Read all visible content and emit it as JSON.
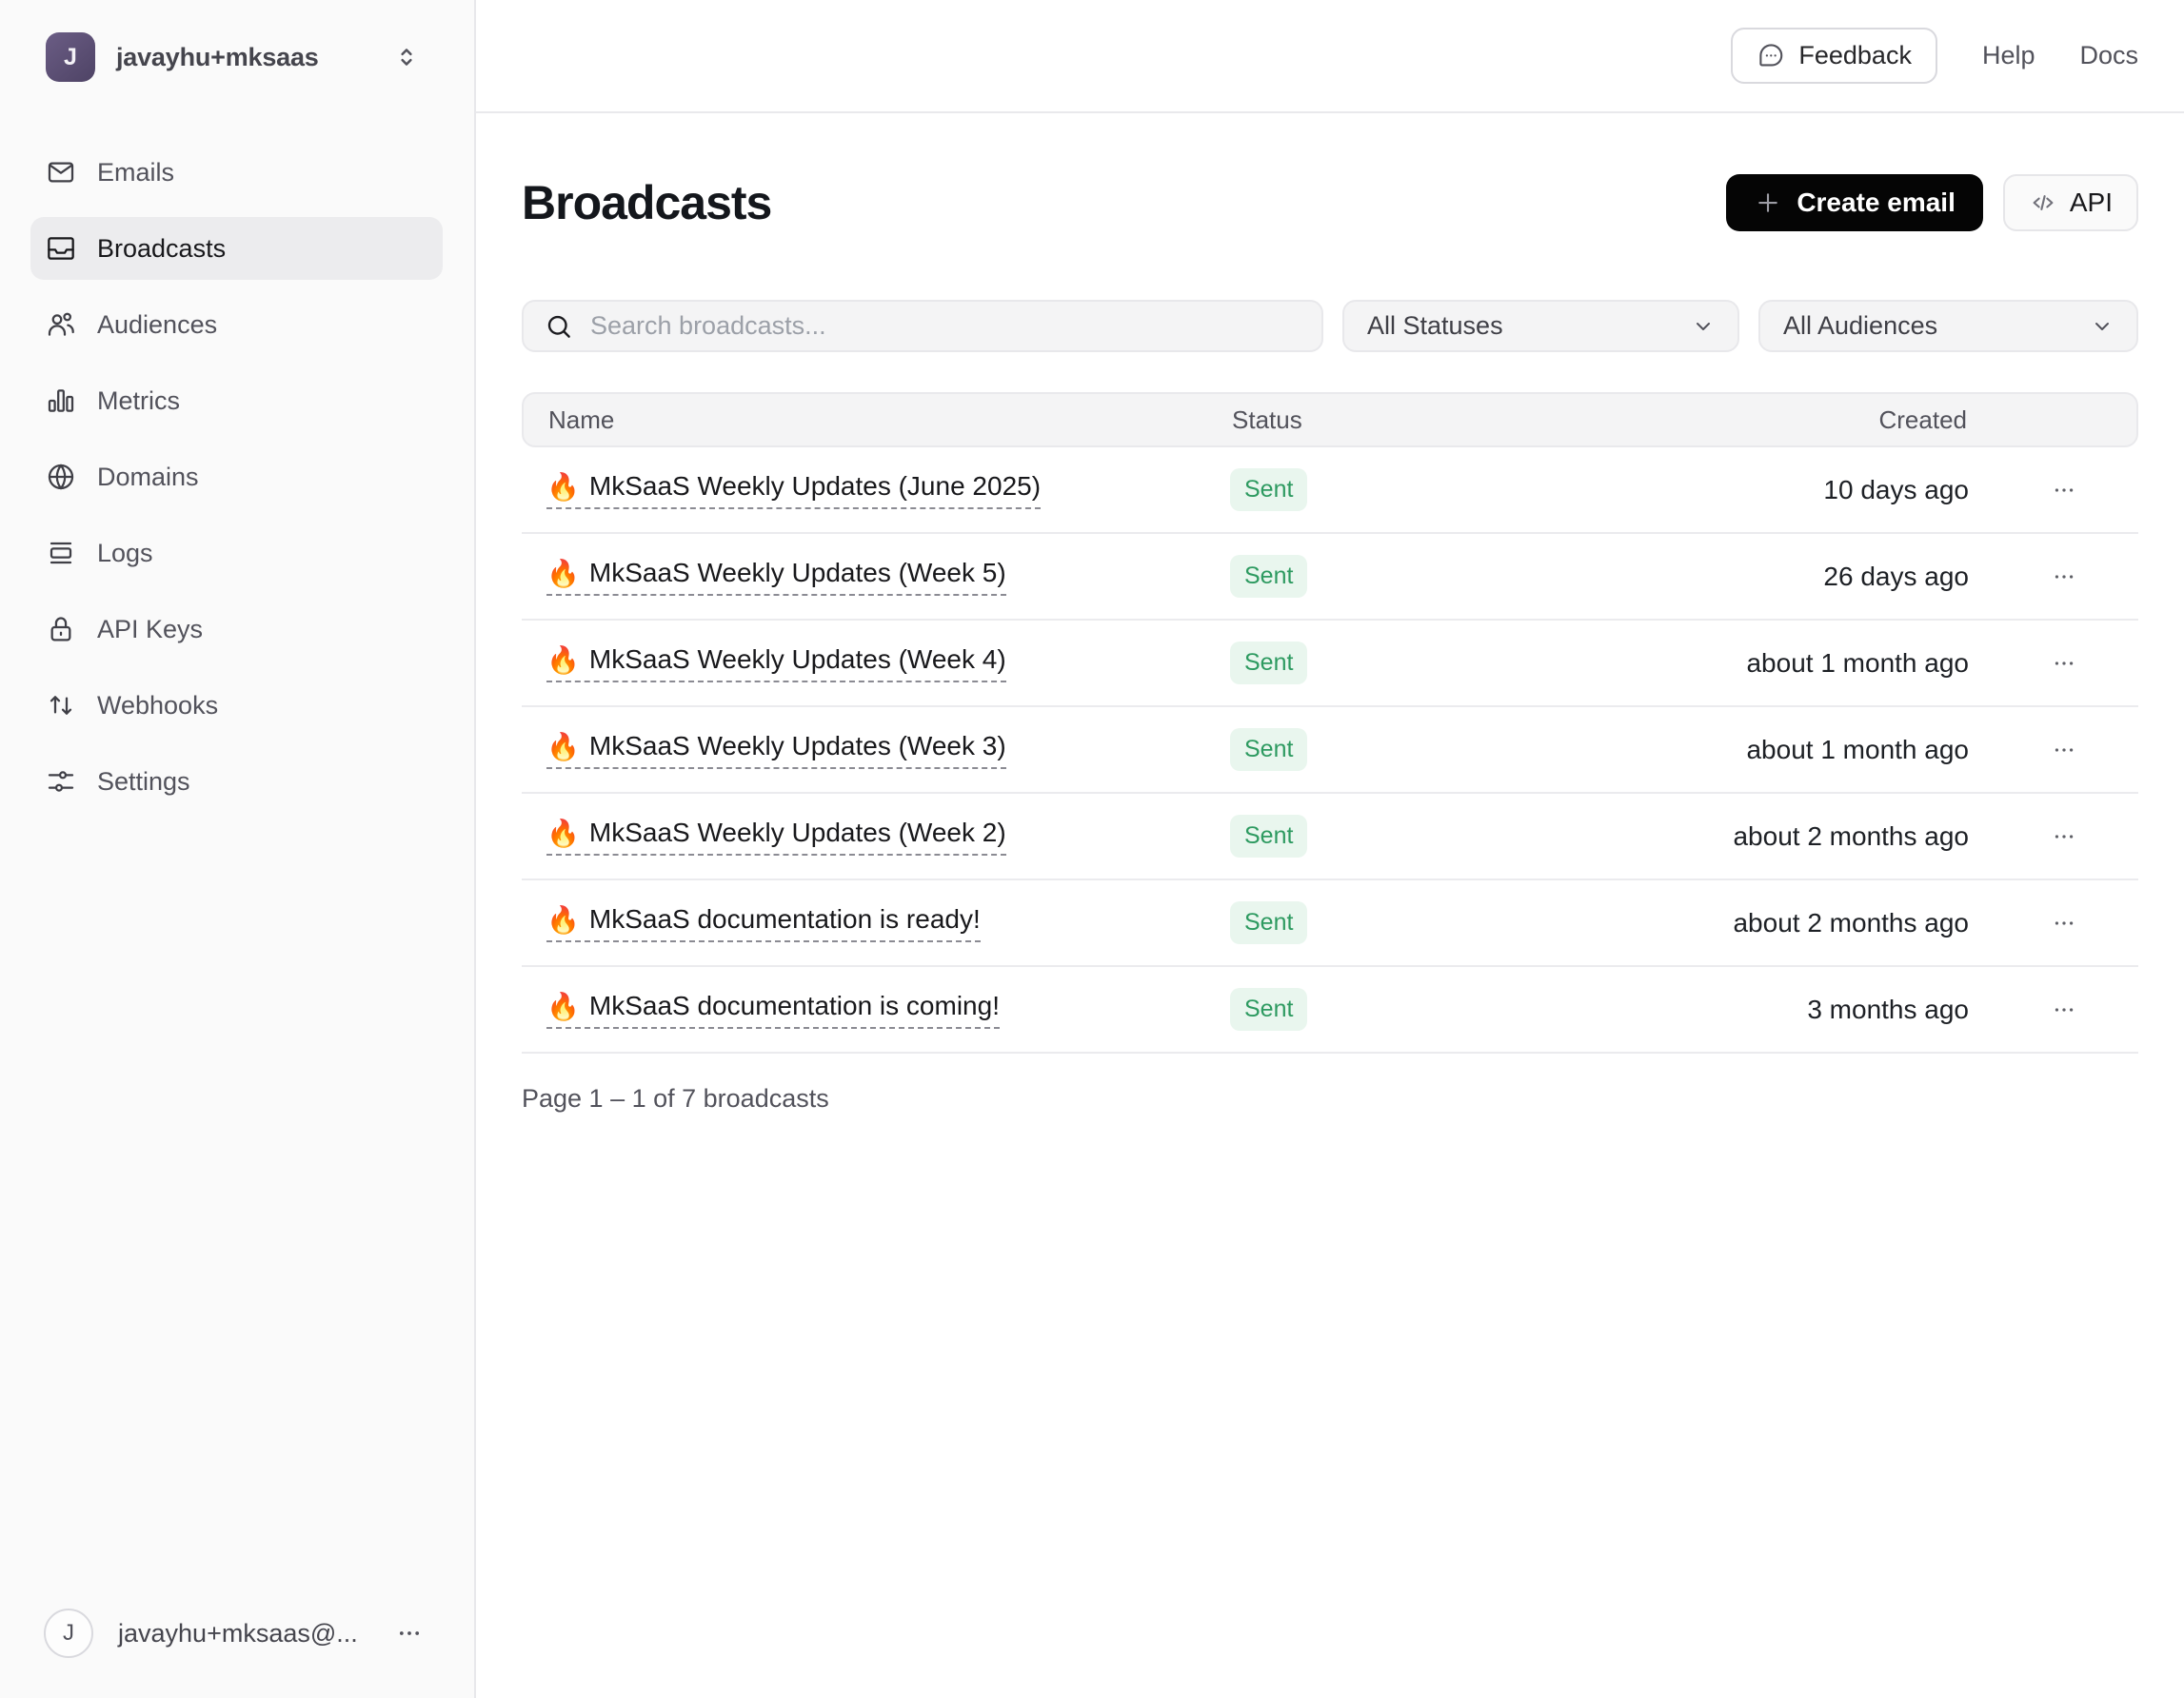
{
  "sidebar": {
    "account": {
      "initial": "J",
      "name": "javayhu+mksaas"
    },
    "items": [
      {
        "label": "Emails",
        "icon": "mail-icon"
      },
      {
        "label": "Broadcasts",
        "icon": "inbox-icon"
      },
      {
        "label": "Audiences",
        "icon": "users-icon"
      },
      {
        "label": "Metrics",
        "icon": "bar-chart-icon"
      },
      {
        "label": "Domains",
        "icon": "globe-icon"
      },
      {
        "label": "Logs",
        "icon": "logs-icon"
      },
      {
        "label": "API Keys",
        "icon": "lock-icon"
      },
      {
        "label": "Webhooks",
        "icon": "arrows-up-down-icon"
      },
      {
        "label": "Settings",
        "icon": "sliders-icon"
      }
    ],
    "footer": {
      "initial": "J",
      "email": "javayhu+mksaas@..."
    }
  },
  "topbar": {
    "feedback_label": "Feedback",
    "help_label": "Help",
    "docs_label": "Docs"
  },
  "page": {
    "title": "Broadcasts",
    "create_email_label": "Create email",
    "api_label": "API",
    "search_placeholder": "Search broadcasts...",
    "status_filter_value": "All Statuses",
    "audience_filter_value": "All Audiences"
  },
  "table": {
    "columns": {
      "name": "Name",
      "status": "Status",
      "created": "Created"
    },
    "rows": [
      {
        "emoji": "🔥",
        "name": "MkSaaS Weekly Updates (June 2025)",
        "status": "Sent",
        "created": "10 days ago"
      },
      {
        "emoji": "🔥",
        "name": "MkSaaS Weekly Updates (Week 5)",
        "status": "Sent",
        "created": "26 days ago"
      },
      {
        "emoji": "🔥",
        "name": "MkSaaS Weekly Updates (Week 4)",
        "status": "Sent",
        "created": "about 1 month ago"
      },
      {
        "emoji": "🔥",
        "name": "MkSaaS Weekly Updates (Week 3)",
        "status": "Sent",
        "created": "about 1 month ago"
      },
      {
        "emoji": "🔥",
        "name": "MkSaaS Weekly Updates (Week 2)",
        "status": "Sent",
        "created": "about 2 months ago"
      },
      {
        "emoji": "🔥",
        "name": "MkSaaS documentation is ready!",
        "status": "Sent",
        "created": "about 2 months ago"
      },
      {
        "emoji": "🔥",
        "name": "MkSaaS documentation is coming!",
        "status": "Sent",
        "created": "3 months ago"
      }
    ],
    "pagination": "Page 1 – 1 of 7 broadcasts"
  },
  "colors": {
    "accent_black": "#050505",
    "badge_bg": "#e9f6ee",
    "badge_text": "#2d9a60",
    "sidebar_bg": "#fafafa",
    "active_item_bg": "#ececee",
    "border": "#e8e8eb",
    "avatar_purple": "#5d5077"
  }
}
